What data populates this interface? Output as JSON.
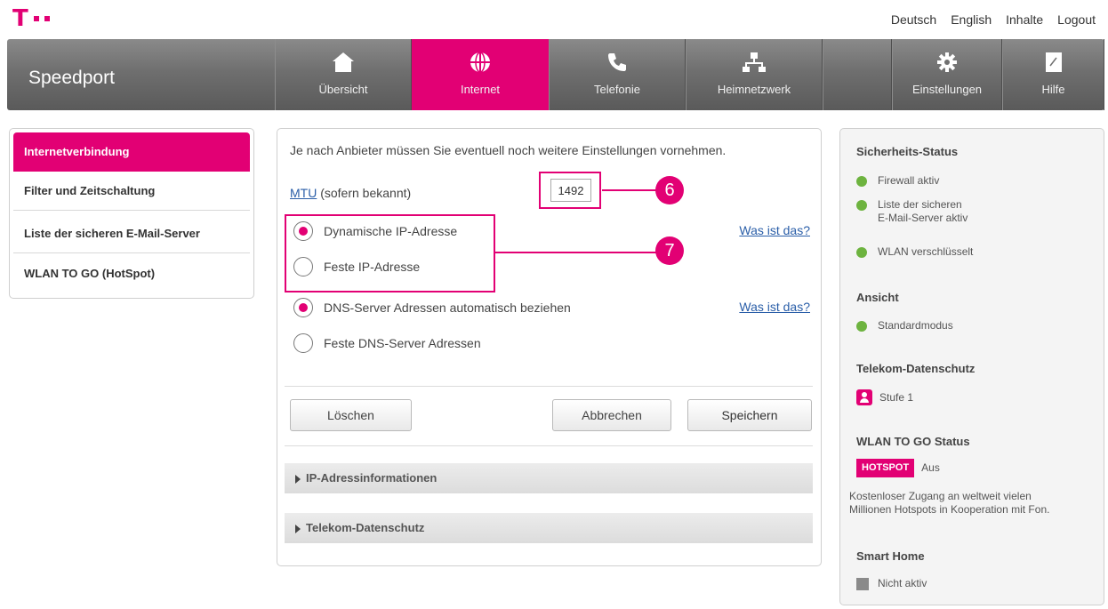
{
  "topbar": {
    "logo_letter": "T",
    "links": [
      "Deutsch",
      "English",
      "Inhalte",
      "Logout"
    ]
  },
  "nav": {
    "brand": "Speedport",
    "items": [
      {
        "label": "Übersicht",
        "icon": "home-icon"
      },
      {
        "label": "Internet",
        "icon": "globe-icon",
        "active": true
      },
      {
        "label": "Telefonie",
        "icon": "phone-icon"
      },
      {
        "label": "Heimnetzwerk",
        "icon": "network-icon"
      },
      {
        "label": "Einstellungen",
        "icon": "gear-icon"
      },
      {
        "label": "Hilfe",
        "icon": "help-book-icon"
      }
    ]
  },
  "sidebar": {
    "items": [
      {
        "label": "Internetverbindung",
        "active": true
      },
      {
        "label": "Filter und Zeitschaltung"
      },
      {
        "label": "Liste der sicheren E-Mail-Server"
      },
      {
        "label": "WLAN TO GO (HotSpot)"
      }
    ]
  },
  "main": {
    "intro": "Je nach Anbieter müssen Sie eventuell noch weitere Einstellungen vornehmen.",
    "mtu_link": "MTU",
    "mtu_suffix": " (sofern bekannt)",
    "mtu_value": "1492",
    "callouts": [
      "6",
      "7"
    ],
    "ip_options": [
      {
        "label": "Dynamische IP-Adresse",
        "selected": true
      },
      {
        "label": "Feste IP-Adresse",
        "selected": false
      }
    ],
    "dns_options": [
      {
        "label": "DNS-Server Adressen automatisch beziehen",
        "selected": true
      },
      {
        "label": "Feste DNS-Server Adressen",
        "selected": false
      }
    ],
    "help_link": "Was ist das?",
    "buttons": {
      "delete": "Löschen",
      "cancel": "Abbrechen",
      "save": "Speichern"
    },
    "accordions": [
      "IP-Adressinformationen",
      "Telekom-Datenschutz"
    ]
  },
  "status": {
    "security_heading": "Sicherheits-Status",
    "security_items": [
      {
        "line1": "Firewall aktiv",
        "line2": ""
      },
      {
        "line1": "Liste der sicheren",
        "line2": "E-Mail-Server aktiv"
      },
      {
        "line1": "WLAN verschlüsselt",
        "line2": ""
      }
    ],
    "view_heading": "Ansicht",
    "view_value": "Standardmodus",
    "privacy_heading": "Telekom-Datenschutz",
    "privacy_value": "Stufe 1",
    "wlan_heading": "WLAN TO GO Status",
    "hotspot_badge": "HOTSPOT",
    "hotspot_state": "Aus",
    "wlan_text_1": "Kostenloser Zugang an weltweit vielen",
    "wlan_text_2": "Millionen Hotspots in Kooperation mit Fon.",
    "smart_home_heading": "Smart Home",
    "smart_home_value": "Nicht aktiv"
  },
  "colors": {
    "brand_magenta": "#e20074",
    "status_green": "#6db33f",
    "link_blue": "#2a5ea8"
  }
}
